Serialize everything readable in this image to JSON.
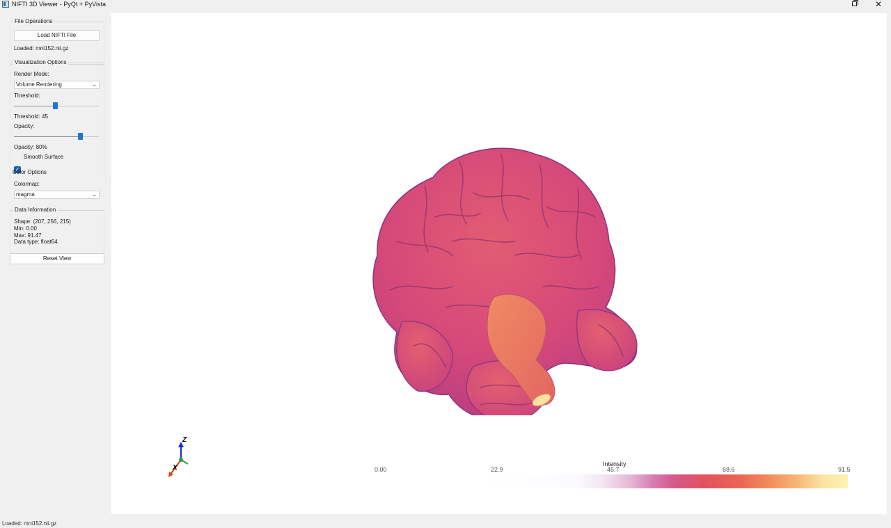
{
  "window": {
    "title": "NIFTI 3D Viewer - PyQt + PyVista"
  },
  "file_operations": {
    "group_title": "File Operations",
    "load_button": "Load NIFTI File",
    "loaded_label": "Loaded: mni152.nii.gz"
  },
  "visualization": {
    "group_title": "Visualization Options",
    "render_mode_label": "Render Mode:",
    "render_mode_value": "Volume Rendering",
    "threshold_label": "Threshold:",
    "threshold_value_label": "Threshold: 45",
    "threshold_fraction": 0.49,
    "opacity_label": "Opacity:",
    "opacity_value_label": "Opacity: 80%",
    "opacity_fraction": 0.8,
    "smooth_surface_label": "Smooth Surface",
    "smooth_surface_checked": true
  },
  "color_options": {
    "group_title": "Color Options",
    "colormap_label": "Colormap:",
    "colormap_value": "magma"
  },
  "data_info": {
    "group_title": "Data Information",
    "shape": "Shape: (207, 256, 215)",
    "min": "Min: 0.00",
    "max": "Max: 91.47",
    "dtype": "Data type: float64"
  },
  "reset_button": "Reset View",
  "viewer": {
    "axes": {
      "z": "Z",
      "x": "X"
    },
    "colorbar": {
      "title": "Intensity",
      "ticks": [
        "0.00",
        "22.9",
        "45.7",
        "68.6",
        "91.5"
      ]
    }
  },
  "status_bar": {
    "text": "Loaded: mni152.nii.gz"
  },
  "colors": {
    "accent": "#1f74d6",
    "brain_base": "#d4487a",
    "brainstem": "#ec7d62"
  }
}
